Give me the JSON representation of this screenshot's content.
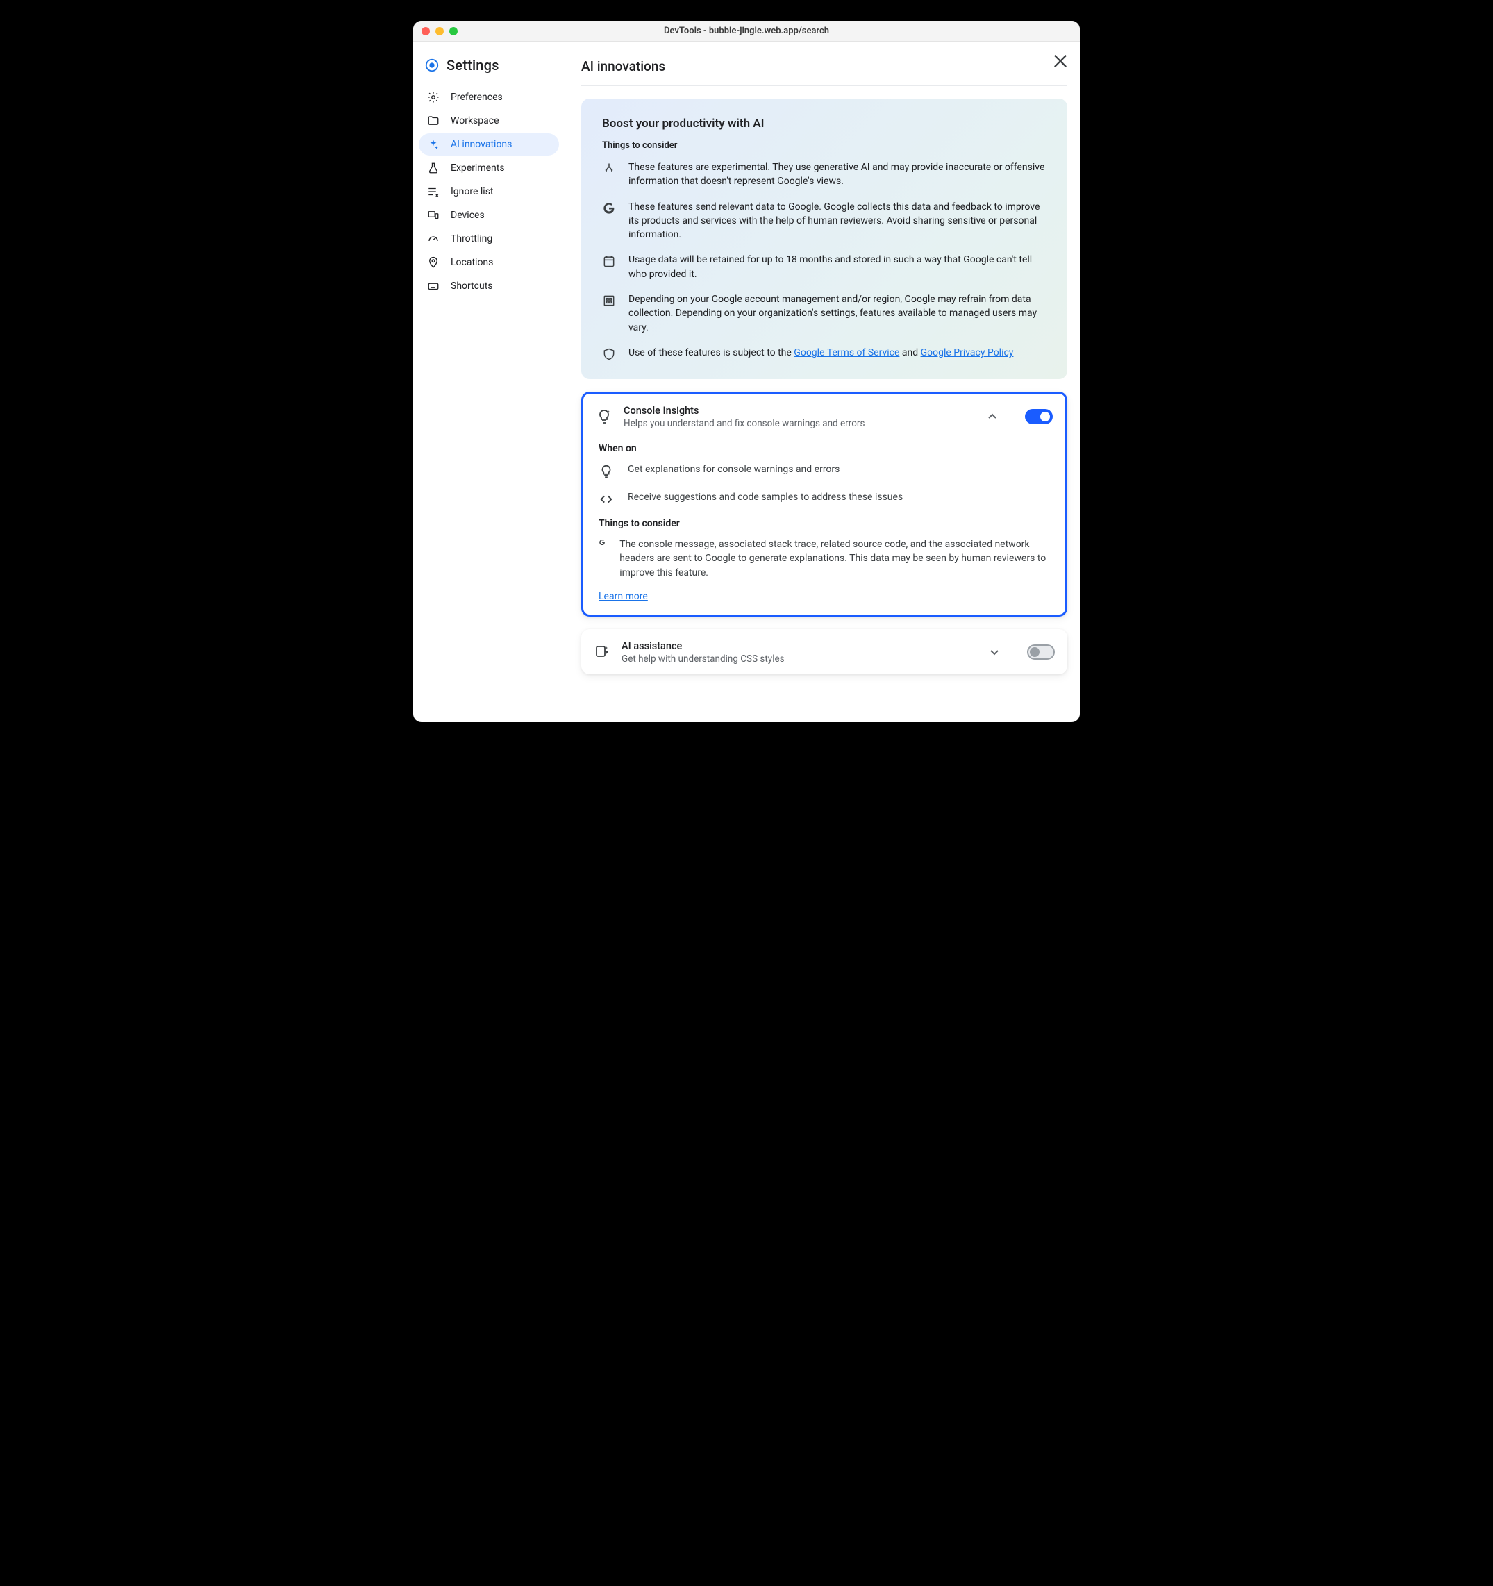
{
  "window_title": "DevTools - bubble-jingle.web.app/search",
  "sidebar": {
    "title": "Settings",
    "items": [
      {
        "label": "Preferences"
      },
      {
        "label": "Workspace"
      },
      {
        "label": "AI innovations"
      },
      {
        "label": "Experiments"
      },
      {
        "label": "Ignore list"
      },
      {
        "label": "Devices"
      },
      {
        "label": "Throttling"
      },
      {
        "label": "Locations"
      },
      {
        "label": "Shortcuts"
      }
    ]
  },
  "page": {
    "title": "AI innovations"
  },
  "info": {
    "heading": "Boost your productivity with AI",
    "subhead": "Things to consider",
    "b0": "These features are experimental. They use generative AI and may provide inaccurate or offensive information that doesn't represent Google's views.",
    "b1": "These features send relevant data to Google. Google collects this data and feedback to improve its products and services with the help of human reviewers. Avoid sharing sensitive or personal information.",
    "b2": "Usage data will be retained for up to 18 months and stored in such a way that Google can't tell who provided it.",
    "b3": "Depending on your Google account management and/or region, Google may refrain from data collection. Depending on your organization's settings, features available to managed users may vary.",
    "b4_pre": "Use of these features is subject to the ",
    "b4_link1": "Google Terms of Service",
    "b4_mid": " and ",
    "b4_link2": "Google Privacy Policy"
  },
  "feat1": {
    "title": "Console Insights",
    "sub": "Helps you understand and fix console warnings and errors",
    "when_on": "When on",
    "r0": "Get explanations for console warnings and errors",
    "r1": "Receive suggestions and code samples to address these issues",
    "consider_h": "Things to consider",
    "consider_t": "The console message, associated stack trace, related source code, and the associated network headers are sent to Google to generate explanations. This data may be seen by human reviewers to improve this feature.",
    "learn": "Learn more",
    "toggle_on": true
  },
  "feat2": {
    "title": "AI assistance",
    "sub": "Get help with understanding CSS styles",
    "toggle_on": false
  }
}
